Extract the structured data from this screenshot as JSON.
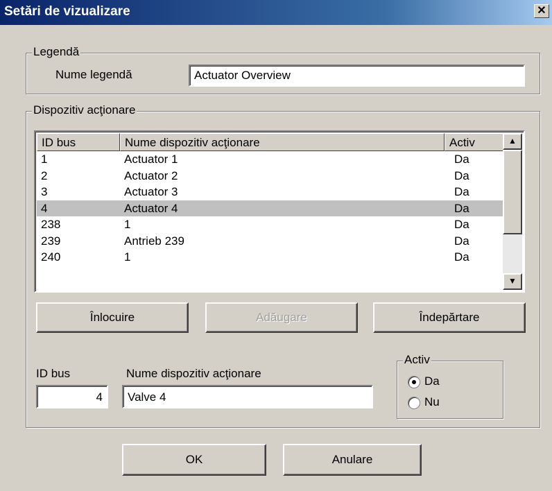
{
  "window": {
    "title": "Setări de vizualizare",
    "close_glyph": "✕"
  },
  "legend_group": {
    "label": "Legendă",
    "name_label": "Nume legendă",
    "name_value": "Actuator Overview"
  },
  "device_group": {
    "label": "Dispozitiv acţionare",
    "columns": [
      "ID bus",
      "Nume dispozitiv acţionare",
      "Activ"
    ],
    "rows": [
      {
        "id": "1",
        "name": "Actuator 1",
        "active": "Da"
      },
      {
        "id": "2",
        "name": "Actuator 2",
        "active": "Da"
      },
      {
        "id": "3",
        "name": "Actuator 3",
        "active": "Da"
      },
      {
        "id": "4",
        "name": "Actuator 4",
        "active": "Da"
      },
      {
        "id": "238",
        "name": "1",
        "active": "Da"
      },
      {
        "id": "239",
        "name": "Antrieb 239",
        "active": "Da"
      },
      {
        "id": "240",
        "name": "1",
        "active": "Da"
      }
    ],
    "selected_row": 3,
    "buttons": {
      "replace": "Înlocuire",
      "add": "Adăugare",
      "remove": "Îndepărtare"
    },
    "edit": {
      "id_label": "ID bus",
      "id_value": "4",
      "name_label": "Nume dispozitiv acţionare",
      "name_value": "Valve 4",
      "active_label": "Activ",
      "option_yes": "Da",
      "option_no": "Nu",
      "selected": "Da"
    }
  },
  "footer": {
    "ok": "OK",
    "cancel": "Anulare"
  },
  "icons": {
    "scroll_up": "▲",
    "scroll_down": "▼"
  }
}
